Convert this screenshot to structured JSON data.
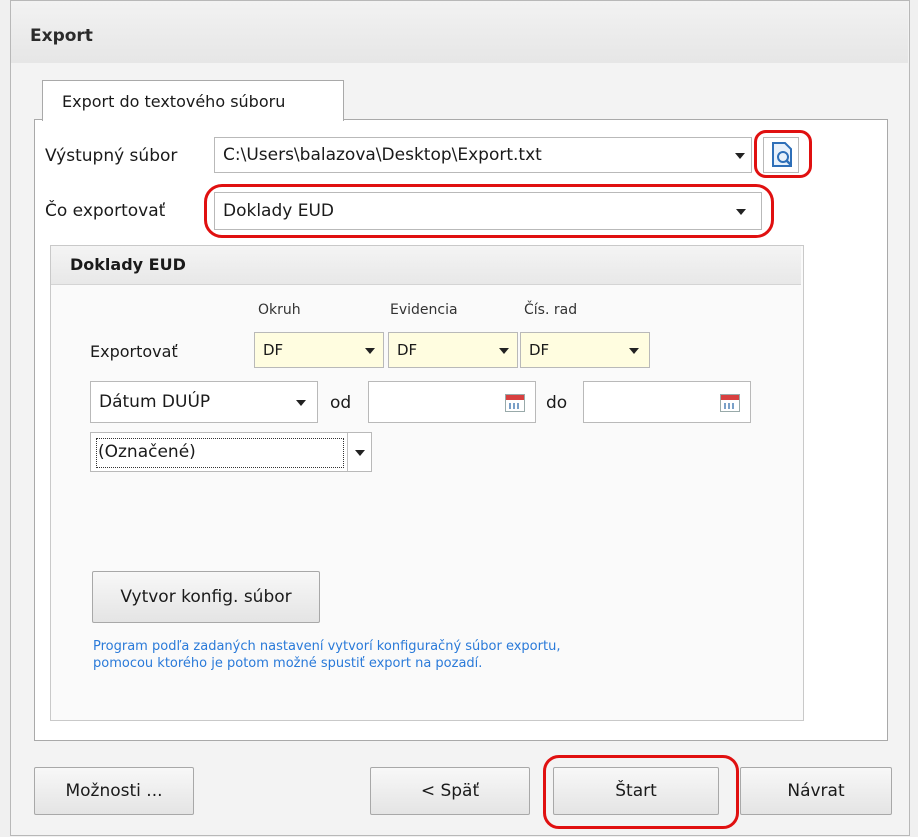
{
  "window": {
    "title": "Export"
  },
  "tab": {
    "label": "Export do textového súboru"
  },
  "output_file": {
    "label": "Výstupný súbor",
    "value": "C:\\Users\\balazova\\Desktop\\Export.txt",
    "browse_icon": "search-file-icon"
  },
  "what_export": {
    "label": "Čo exportovať",
    "value": "Doklady EUD"
  },
  "group": {
    "title": "Doklady EUD",
    "export_label": "Exportovať",
    "columns": [
      "Okruh",
      "Evidencia",
      "Čís. rad"
    ],
    "values": [
      "DF",
      "DF",
      "DF"
    ],
    "date_field": "Dátum DUÚP",
    "from_label": "od",
    "to_label": "do",
    "from_value": "",
    "to_value": "",
    "selection": "(Označené)",
    "create_config_button": "Vytvor konfig. súbor",
    "info_text": [
      "Program podľa zadaných nastavení vytvorí konfiguračný súbor exportu,",
      "pomocou ktorého je potom možné spustiť export na pozadí."
    ]
  },
  "buttons": {
    "options": "Možnosti ...",
    "back": "< Späť",
    "start": "Štart",
    "return": "Návrat"
  },
  "colors": {
    "highlight": "#e01010",
    "info_text": "#2a7ad9",
    "yellow_field": "#fffde0"
  }
}
